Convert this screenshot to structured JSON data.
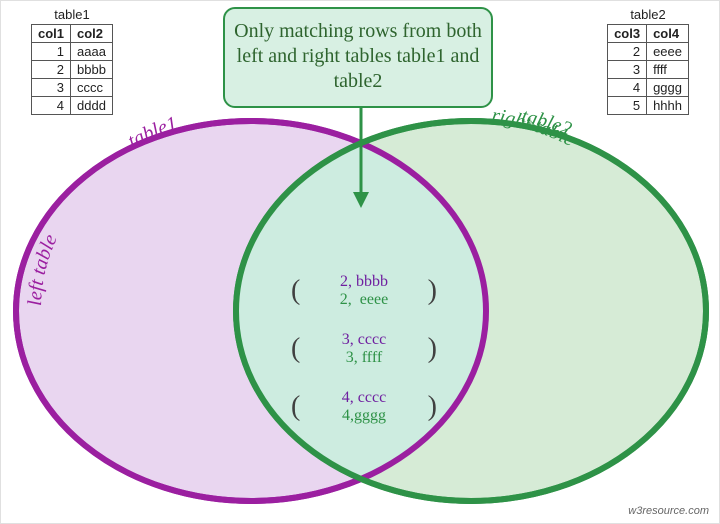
{
  "table1": {
    "caption": "table1",
    "headers": [
      "col1",
      "col2"
    ],
    "rows": [
      [
        "1",
        "aaaa"
      ],
      [
        "2",
        "bbbb"
      ],
      [
        "3",
        "cccc"
      ],
      [
        "4",
        "dddd"
      ]
    ]
  },
  "table2": {
    "caption": "table2",
    "headers": [
      "col3",
      "col4"
    ],
    "rows": [
      [
        "2",
        "eeee"
      ],
      [
        "3",
        "ffff"
      ],
      [
        "4",
        "gggg"
      ],
      [
        "5",
        "hhhh"
      ]
    ]
  },
  "callout": {
    "text": "Only matching rows from both left and right tables table1 and table2"
  },
  "labels": {
    "left_outer": "left table",
    "left_inner": "table1",
    "right_outer": "right table",
    "right_inner": "table2"
  },
  "intersection": {
    "pairs": [
      {
        "left": "2, bbbb",
        "right": "2,  eeee"
      },
      {
        "left": "3, cccc",
        "right": "3, ffff"
      },
      {
        "left": "4, cccc",
        "right": "4,gggg"
      }
    ]
  },
  "colors": {
    "left_stroke": "#9b1fa0",
    "left_fill": "#e9d6f0",
    "right_stroke": "#2e9247",
    "right_fill": "#cfe7cf",
    "inter_fill": "#cdece0"
  },
  "footer": "w3resource.com"
}
